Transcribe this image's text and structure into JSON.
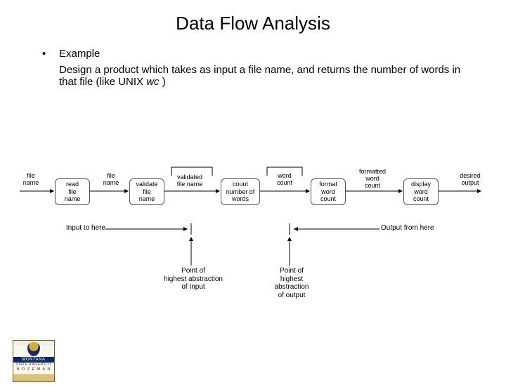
{
  "title": "Data Flow Analysis",
  "bullet": {
    "label": "Example",
    "body_pre": "Design a product which takes as input a file name, and returns the number of words in that file (like UNIX ",
    "body_italic": "wc",
    "body_post": " )"
  },
  "diagram": {
    "labels": {
      "file_name_in": "file\nname",
      "file_name_mid": "file\nname",
      "validated": "validated\nfile name",
      "word_count": "word\ncount",
      "formatted": "formatted\nword\ncount",
      "desired": "desired\noutput"
    },
    "boxes": {
      "read": "read\nfile\nname",
      "validate": "validate\nfile\nname",
      "count": "count\nnumber of\nwords",
      "format": "format\nword\ncount",
      "display": "display\nword\ncount"
    },
    "annotations": {
      "input_to_here": "Input to here",
      "output_from_here": "Output from here",
      "poi_input": "Point of\nhighest abstraction\nof Input",
      "poi_output": "Point of\nhighest\nabstraction\nof output"
    }
  },
  "logo": {
    "name": "MONTANA",
    "sub": "STATE UNIVERSITY",
    "city": "B O Z E M A N"
  }
}
